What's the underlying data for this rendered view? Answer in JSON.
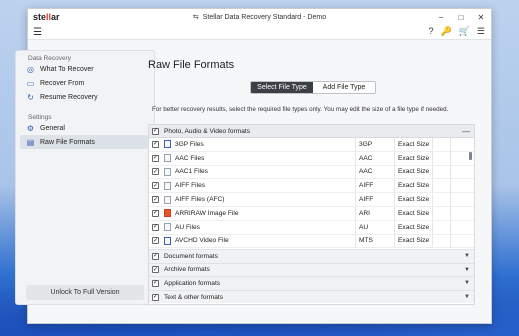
{
  "window": {
    "logo_pre": "ste",
    "logo_mid": "ll",
    "logo_post": "ar",
    "title": "Stellar Data Recovery Standard - Demo",
    "controls": {
      "minimize": "−",
      "maximize": "□",
      "close": "✕"
    }
  },
  "toolbar": {
    "menu_icon": "☰",
    "icons": [
      "?",
      "🔑",
      "🛒",
      "☰"
    ]
  },
  "sidebar": {
    "group1": "Data Recovery",
    "items1": [
      {
        "label": "What To Recover",
        "icon": "◎"
      },
      {
        "label": "Recover From",
        "icon": "▭"
      },
      {
        "label": "Resume Recovery",
        "icon": "↻"
      }
    ],
    "group2": "Settings",
    "items2": [
      {
        "label": "General",
        "icon": "⚙"
      },
      {
        "label": "Raw File Formats",
        "icon": "▤"
      }
    ],
    "unlock_label": "Unlock To Full Version"
  },
  "main": {
    "title": "Raw File Formats",
    "tab_select": "Select File Type",
    "tab_add": "Add File Type",
    "hint": "For better recovery results, select the required file types only. You may edit the size of a file type if needed.",
    "section_open": "Photo, Audio & Video formats",
    "rows": [
      {
        "name": "3GP Files",
        "ext": "3GP",
        "size": "Exact Size"
      },
      {
        "name": "AAC Files",
        "ext": "AAC",
        "size": "Exact Size"
      },
      {
        "name": "AAC1 Files",
        "ext": "AAC",
        "size": "Exact Size"
      },
      {
        "name": "AIFF Files",
        "ext": "AIFF",
        "size": "Exact Size"
      },
      {
        "name": "AIFF Files (AFC)",
        "ext": "AIFF",
        "size": "Exact Size"
      },
      {
        "name": "ARRIRAW Image File",
        "ext": "ARI",
        "size": "Exact Size"
      },
      {
        "name": "AU Files",
        "ext": "AU",
        "size": "Exact Size"
      },
      {
        "name": "AVCHD Video File",
        "ext": "MTS",
        "size": "Exact Size"
      }
    ],
    "sections_collapsed": [
      "Document formats",
      "Archive formats",
      "Application formats",
      "Text & other formats"
    ]
  }
}
